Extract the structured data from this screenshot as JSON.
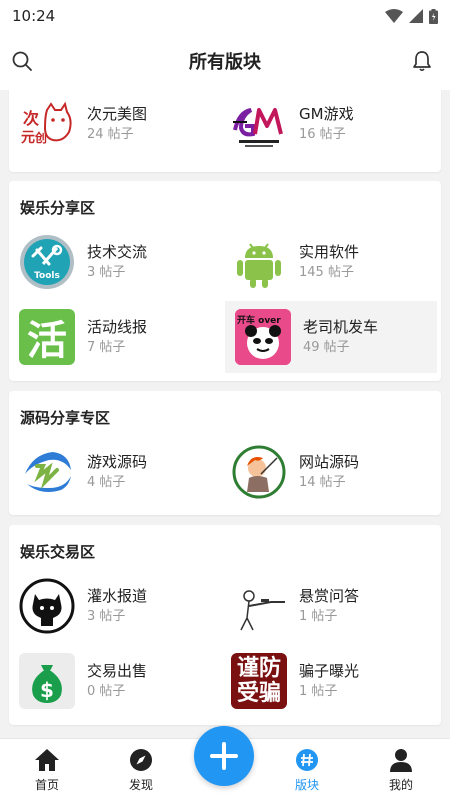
{
  "status": {
    "time": "10:24"
  },
  "header": {
    "title": "所有版块"
  },
  "sections": [
    {
      "title": "",
      "boards": [
        {
          "name": "次元美图",
          "count": "24 帖子",
          "icon": "anime-icon"
        },
        {
          "name": "GM游戏",
          "count": "16 帖子",
          "icon": "gm-creative-icon"
        }
      ]
    },
    {
      "title": "娱乐分享区",
      "boards": [
        {
          "name": "技术交流",
          "count": "3 帖子",
          "icon": "tools-icon"
        },
        {
          "name": "实用软件",
          "count": "145 帖子",
          "icon": "android-icon"
        },
        {
          "name": "活动线报",
          "count": "7 帖子",
          "icon": "huo-icon",
          "glyph": "活"
        },
        {
          "name": "老司机发车",
          "count": "49 帖子",
          "icon": "panda-icon",
          "overlay": "开车 over"
        }
      ]
    },
    {
      "title": "源码分享专区",
      "boards": [
        {
          "name": "游戏源码",
          "count": "4 帖子",
          "icon": "game-source-icon"
        },
        {
          "name": "网站源码",
          "count": "14 帖子",
          "icon": "web-source-icon"
        }
      ]
    },
    {
      "title": "娱乐交易区",
      "boards": [
        {
          "name": "灌水报道",
          "count": "3 帖子",
          "icon": "github-cat-icon"
        },
        {
          "name": "悬赏问答",
          "count": "1 帖子",
          "icon": "sniper-icon"
        },
        {
          "name": "交易出售",
          "count": "0 帖子",
          "icon": "money-bag-icon"
        },
        {
          "name": "骗子曝光",
          "count": "1 帖子",
          "icon": "anti-fraud-icon",
          "glyph": "谨防受骗"
        }
      ]
    }
  ],
  "nav": [
    {
      "label": "首页",
      "icon": "home-icon"
    },
    {
      "label": "发现",
      "icon": "compass-icon"
    },
    {
      "label": "版块",
      "icon": "hashtag-icon",
      "active": true
    },
    {
      "label": "我的",
      "icon": "person-icon"
    }
  ],
  "colors": {
    "accent": "#2196f3"
  }
}
